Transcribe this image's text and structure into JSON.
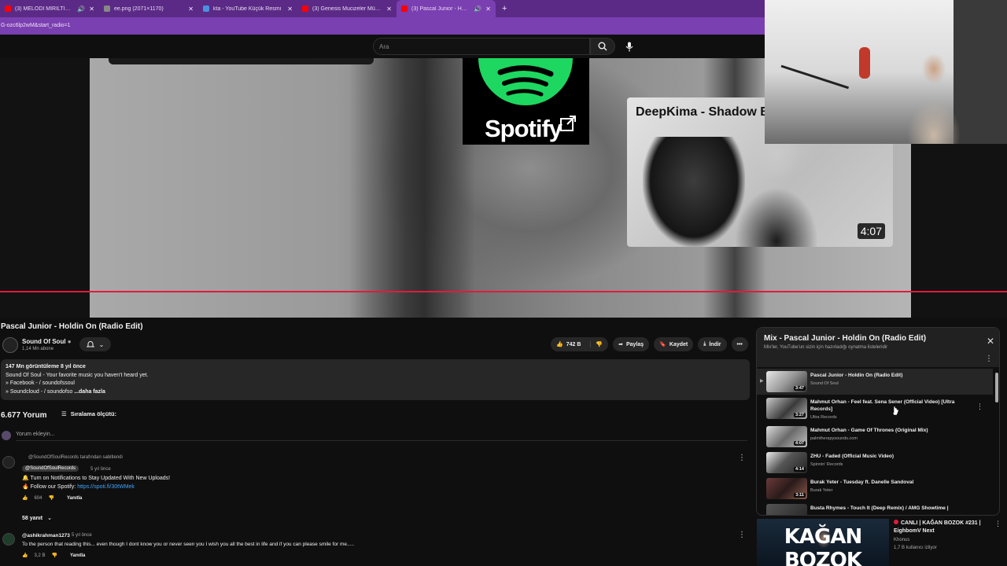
{
  "browser": {
    "tabs": [
      {
        "title": "(3) MELODİ MIRILTISI | Eigh",
        "favicon_color": "#ff0000"
      },
      {
        "title": "ee.png (2071×1170)",
        "favicon_color": "#888888"
      },
      {
        "title": "kta - YouTube Küçük Resmi",
        "favicon_color": "#4a90e2"
      },
      {
        "title": "(3) Genesis Mucizeler Müzesi -",
        "favicon_color": "#ff0000"
      },
      {
        "title": "(3) Pascal Junior - Holdin O",
        "favicon_color": "#ff0000"
      }
    ],
    "new_tab": "+",
    "url": "G-ozc6lp2wM&start_radio=1"
  },
  "search": {
    "placeholder": "Ara"
  },
  "video": {
    "endcard_title": "DeepKima - Shadow B",
    "endcard_duration": "4:07",
    "spotify_text": "Spotify",
    "progress_color": "#e21b3c"
  },
  "meta": {
    "title": "Pascal Junior - Holdin On (Radio Edit)",
    "channel": "Sound Of Soul",
    "subscribers": "1,14 Mn abone",
    "like_count": "742 B",
    "share": "Paylaş",
    "save": "Kaydet",
    "download": "İndir"
  },
  "description": {
    "stats": "147 Mn görüntüleme  8 yıl önce",
    "line1": "Sound Of Soul - Your favorite music you haven't heard yet.",
    "line2": "» Facebook -  / soundofssoul",
    "line3": "» Soundcloud -  / soundofso",
    "more": "...daha fazla"
  },
  "comments": {
    "count": "6.677 Yorum",
    "sort_label": "Sıralama ölçütü:",
    "add_placeholder": "Yorum ekleyin...",
    "pinned_by": "@SoundOfSoulRecords tarafından sabitlendi",
    "items": [
      {
        "author": "@SoundOfSoulRecords",
        "time": "5 yıl önce",
        "line1": "🔔 Turn on Notifications to Stay Updated With New Uploads!",
        "line2_prefix": "🔥 Follow our Spotify: ",
        "line2_link": "https://spoti.fi/30tWMek",
        "likes": "604",
        "reply": "Yanıtla",
        "replies": "58 yanıt"
      },
      {
        "author": "@ashikrahman1273",
        "time": "5 yıl önce",
        "line1": "To the person that reading this... even though I dont know you or never seen you I wish you all the best in life and if you can please smile for me.....",
        "likes": "3,2 B",
        "reply": "Yanıtla"
      }
    ]
  },
  "playlist": {
    "title": "Mix - Pascal Junior - Holdin On (Radio Edit)",
    "subtitle": "Mix'ler, YouTube'un sizin için hazırladığı oynatma listeleridir",
    "items": [
      {
        "title": "Pascal Junior - Holdin On (Radio Edit)",
        "channel": "Sound Of Soul",
        "duration": "3:47"
      },
      {
        "title": "Mahmut Orhan - Feel feat. Sena Sener (Official Video) [Ultra Records]",
        "channel": "Ultra Records",
        "duration": "3:27"
      },
      {
        "title": "Mahmut Orhan - Game Of Thrones (Original Mix)",
        "channel": "palmtherapysounds.com",
        "duration": "4:07"
      },
      {
        "title": "ZHU - Faded (Official Music Video)",
        "channel": "Spinnin' Records",
        "duration": "4:14"
      },
      {
        "title": "Burak Yeter - Tuesday ft. Danelle Sandoval",
        "channel": "Burak Yeter",
        "duration": "3:11"
      },
      {
        "title": "Busta Rhymes - Touch It (Deep Remix) / AMG Showtime |",
        "channel": "",
        "duration": ""
      }
    ]
  },
  "recommendation": {
    "thumb_text": "KAĞAN BOZOK",
    "title": "CANLI | KAĞAN BOZOK #231 | EighbomV Next",
    "channel": "Khonus",
    "viewers": "1,7 B kullanıcı izliyor"
  }
}
